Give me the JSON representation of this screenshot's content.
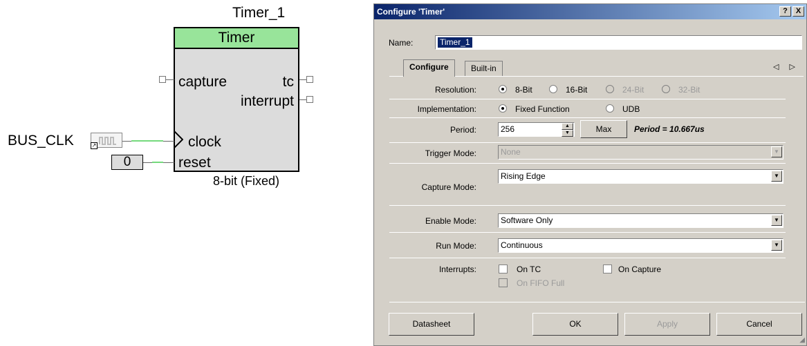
{
  "schematic": {
    "instance_name": "Timer_1",
    "component_type": "Timer",
    "pins": {
      "capture": "capture",
      "tc": "tc",
      "interrupt": "interrupt",
      "clock": "clock",
      "reset": "reset"
    },
    "clock_source": "BUS_CLK",
    "reset_value": "0",
    "footnote": "8-bit (Fixed)",
    "colors": {
      "header": "#98e49a",
      "body": "#dcdcdc",
      "wire": "#74d97c"
    }
  },
  "dialog": {
    "title": "Configure 'Timer'",
    "title_buttons": {
      "help": "?",
      "close": "X"
    },
    "name_label": "Name:",
    "name_value": "Timer_1",
    "tabs": [
      "Configure",
      "Built-in"
    ],
    "tab_arrows": "◁ ▷",
    "resolution": {
      "label": "Resolution:",
      "options": [
        "8-Bit",
        "16-Bit",
        "24-Bit",
        "32-Bit"
      ],
      "selected": "8-Bit"
    },
    "implementation": {
      "label": "Implementation:",
      "options": [
        "Fixed Function",
        "UDB"
      ],
      "selected": "Fixed Function"
    },
    "period": {
      "label": "Period:",
      "value": "256",
      "max_button": "Max",
      "info": "Period = 10.667us"
    },
    "trigger_mode": {
      "label": "Trigger Mode:",
      "value": "None"
    },
    "capture_mode": {
      "label": "Capture Mode:",
      "value": "Rising Edge"
    },
    "enable_mode": {
      "label": "Enable Mode:",
      "value": "Software Only"
    },
    "run_mode": {
      "label": "Run Mode:",
      "value": "Continuous"
    },
    "interrupts": {
      "label": "Interrupts:",
      "on_tc": "On TC",
      "on_capture": "On Capture",
      "on_fifo_full": "On FIFO Full"
    },
    "buttons": {
      "datasheet": "Datasheet",
      "ok": "OK",
      "apply": "Apply",
      "cancel": "Cancel"
    }
  }
}
